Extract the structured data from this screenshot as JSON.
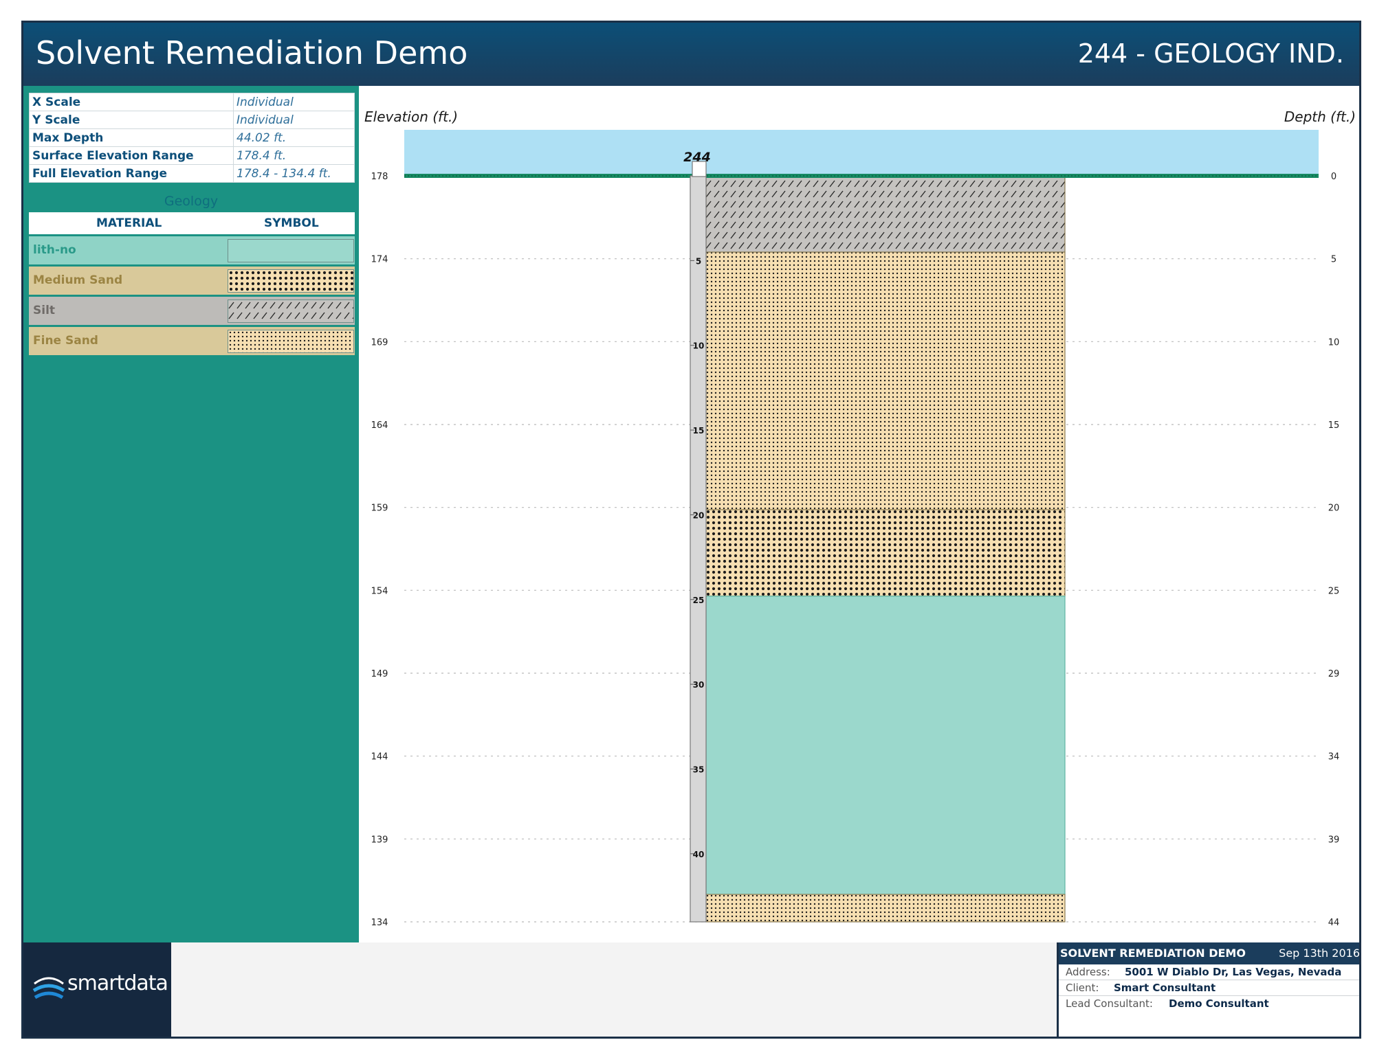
{
  "header": {
    "title": "Solvent Remediation Demo",
    "well": "244 - GEOLOGY IND."
  },
  "info": [
    {
      "key": "X Scale",
      "value": "Individual"
    },
    {
      "key": "Y Scale",
      "value": "Individual"
    },
    {
      "key": "Max Depth",
      "value": "44.02 ft."
    },
    {
      "key": "Surface Elevation Range",
      "value": "178.4 ft."
    },
    {
      "key": "Full Elevation Range",
      "value": "178.4 - 134.4 ft."
    }
  ],
  "geology": {
    "title": "Geology",
    "col_material": "MATERIAL",
    "col_symbol": "SYMBOL",
    "materials": [
      {
        "name": "lith-no",
        "pattern": "none",
        "bg": "#8fd3c6",
        "text_color": "#2a9a89"
      },
      {
        "name": "Medium Sand",
        "pattern": "medium-dots",
        "bg": "#d9c99a",
        "text_color": "#9b8443"
      },
      {
        "name": "Silt",
        "pattern": "hatch",
        "bg": "#bdbbb8",
        "text_color": "#6f6b68"
      },
      {
        "name": "Fine Sand",
        "pattern": "fine-dots",
        "bg": "#d9c99a",
        "text_color": "#9b8443"
      }
    ]
  },
  "plot": {
    "elevation_label": "Elevation (ft.)",
    "depth_label": "Depth (ft.)",
    "well_label": "244",
    "elevation_ticks": [
      "178",
      "174",
      "169",
      "164",
      "159",
      "154",
      "149",
      "144",
      "139",
      "134"
    ],
    "depth_ticks": [
      "0",
      "5",
      "10",
      "15",
      "20",
      "25",
      "29",
      "34",
      "39",
      "44"
    ],
    "casing_ticks": [
      "5",
      "10",
      "15",
      "20",
      "25",
      "30",
      "35",
      "40"
    ],
    "max_depth": 44.02,
    "layers": [
      {
        "material": "Silt",
        "top": 0,
        "bottom": 4.5,
        "pattern": "hatch",
        "fill": "#c5c3c0"
      },
      {
        "material": "Fine Sand",
        "top": 4.5,
        "bottom": 19.7,
        "pattern": "fine-dots",
        "fill": "#f6dfb2"
      },
      {
        "material": "Medium Sand",
        "top": 19.7,
        "bottom": 24.8,
        "pattern": "medium-dots",
        "fill": "#f6dfb2"
      },
      {
        "material": "lith-no",
        "top": 24.8,
        "bottom": 42.4,
        "pattern": "none",
        "fill": "#9bd8cc"
      },
      {
        "material": "Fine Sand",
        "top": 42.4,
        "bottom": 44.02,
        "pattern": "fine-dots",
        "fill": "#f6dfb2"
      }
    ],
    "colors": {
      "sky": "#aee0f4",
      "ground_line": "#168a63",
      "grid": "#b9b9b9"
    }
  },
  "footer": {
    "logo_text": "smartdata",
    "project": "SOLVENT REMEDIATION DEMO",
    "date": "Sep 13th 2016",
    "address_label": "Address:",
    "address": "5001 W Diablo Dr, Las Vegas, Nevada",
    "client_label": "Client:",
    "client": "Smart Consultant",
    "lead_label": "Lead Consultant:",
    "lead": "Demo Consultant"
  }
}
